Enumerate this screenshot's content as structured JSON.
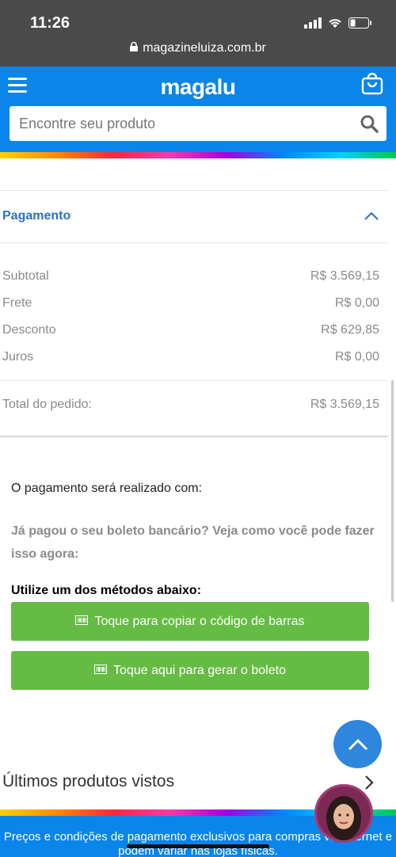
{
  "status_bar": {
    "time": "11:26",
    "url": "magazineluiza.com.br"
  },
  "header": {
    "logo": "magalu",
    "search_placeholder": "Encontre seu produto"
  },
  "payment": {
    "title": "Pagamento",
    "rows": [
      {
        "label": "Subtotal",
        "value": "R$ 3.569,15"
      },
      {
        "label": "Frete",
        "value": "R$ 0,00"
      },
      {
        "label": "Desconto",
        "value": "R$ 629,85"
      },
      {
        "label": "Juros",
        "value": "R$ 0,00"
      }
    ],
    "total_label": "Total do pedido:",
    "total_value": "R$ 3.569,15"
  },
  "boleto": {
    "message": "O pagamento será realizado com:",
    "question": "Já pagou o seu boleto bancário? Veja como você pode fazer isso agora:",
    "methods_label": "Utilize um dos métodos abaixo:",
    "copy_button": "Toque para copiar o código de barras",
    "generate_button": "Toque aqui para gerar o boleto"
  },
  "recent": {
    "title": "Últimos produtos vistos"
  },
  "footer": {
    "text": "Preços e condições de pagamento exclusivos para compras via internet e podem variar nas lojas físicas."
  },
  "colors": {
    "brand_blue": "#0a85ea",
    "button_green": "#66bb44",
    "link_blue": "#2d6fc2"
  }
}
